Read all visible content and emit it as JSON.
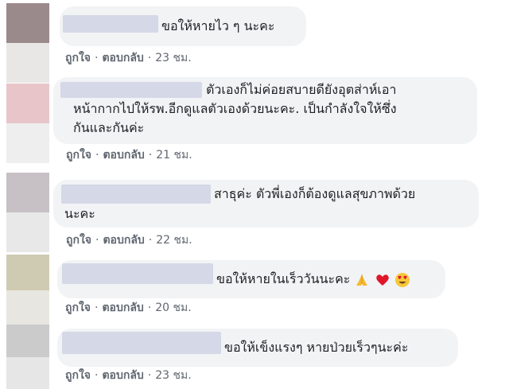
{
  "comments": [
    {
      "text_lines": [
        "ขอให้หายไว ๆ นะคะ"
      ],
      "like_label": "ถูกใจ",
      "reply_label": "ตอบกลับ",
      "time": "23 ชม."
    },
    {
      "text_lines": [
        "ตัวเองก็ไม่ค่อยสบายดียังอุตส่าห์เอา",
        "หน้ากากไปให้รพ.อีกดูแลตัวเองด้วยนะคะ. เป็นกำลังใจให้ซึ่ง",
        "กันและกันค่ะ"
      ],
      "like_label": "ถูกใจ",
      "reply_label": "ตอบกลับ",
      "time": "21 ชม."
    },
    {
      "text_lines": [
        "สาธุค่ะ ตัวพี่เองก็ต้องดูแลสุขภาพด้วย",
        "นะคะ"
      ],
      "like_label": "ถูกใจ",
      "reply_label": "ตอบกลับ",
      "time": "22 ชม."
    },
    {
      "text_lines": [
        "ขอให้หายในเร็ววันนะคะ"
      ],
      "emojis": [
        "folded-hands-emoji",
        "red-heart-emoji",
        "heart-eyes-emoji"
      ],
      "like_label": "ถูกใจ",
      "reply_label": "ตอบกลับ",
      "time": "20 ชม."
    },
    {
      "text_lines": [
        "ขอให้เข็งแรงๆ หายป่วยเร็วๆนะค่ะ"
      ],
      "like_label": "ถูกใจ",
      "reply_label": "ตอบกลับ",
      "time": "23 ชม."
    }
  ],
  "separator": "·",
  "colors": {
    "bubble": "#f2f3f5",
    "text": "#1c1e21",
    "meta": "#606770",
    "name_blur": "#d5d8e6"
  }
}
